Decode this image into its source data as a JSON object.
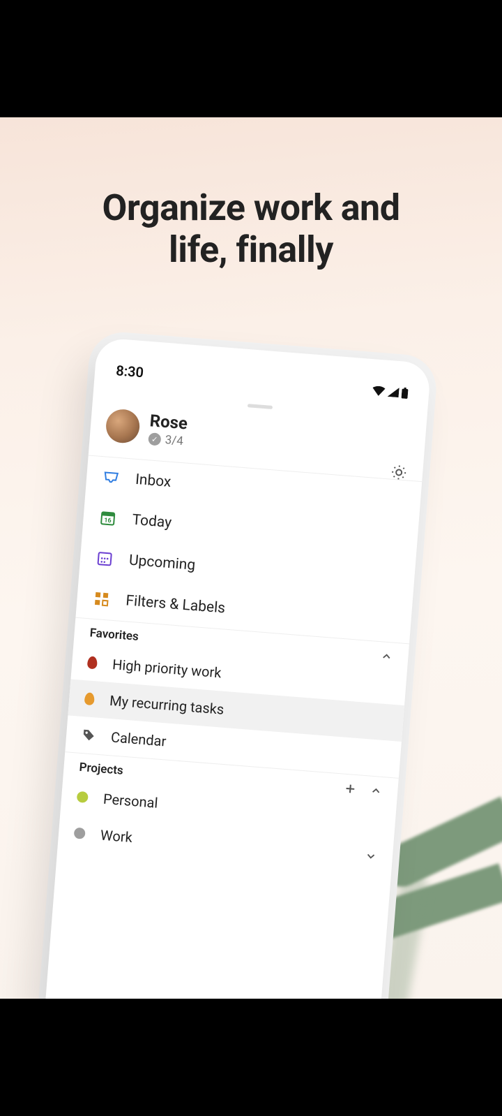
{
  "headline_line1": "Organize work and",
  "headline_line2": "life, finally",
  "status": {
    "time": "8:30"
  },
  "profile": {
    "name": "Rose",
    "progress": "3/4"
  },
  "nav": {
    "inbox": "Inbox",
    "today": "Today",
    "upcoming": "Upcoming",
    "filters": "Filters & Labels"
  },
  "sections": {
    "favorites_label": "Favorites",
    "projects_label": "Projects"
  },
  "favorites": [
    {
      "label": "High priority work",
      "color": "#b03020"
    },
    {
      "label": "My recurring tasks",
      "color": "#e69a2e"
    },
    {
      "label": "Calendar"
    }
  ],
  "projects": [
    {
      "label": "Personal",
      "color": "#b7cc3f"
    },
    {
      "label": "Work",
      "color": "#9e9e9e"
    }
  ]
}
